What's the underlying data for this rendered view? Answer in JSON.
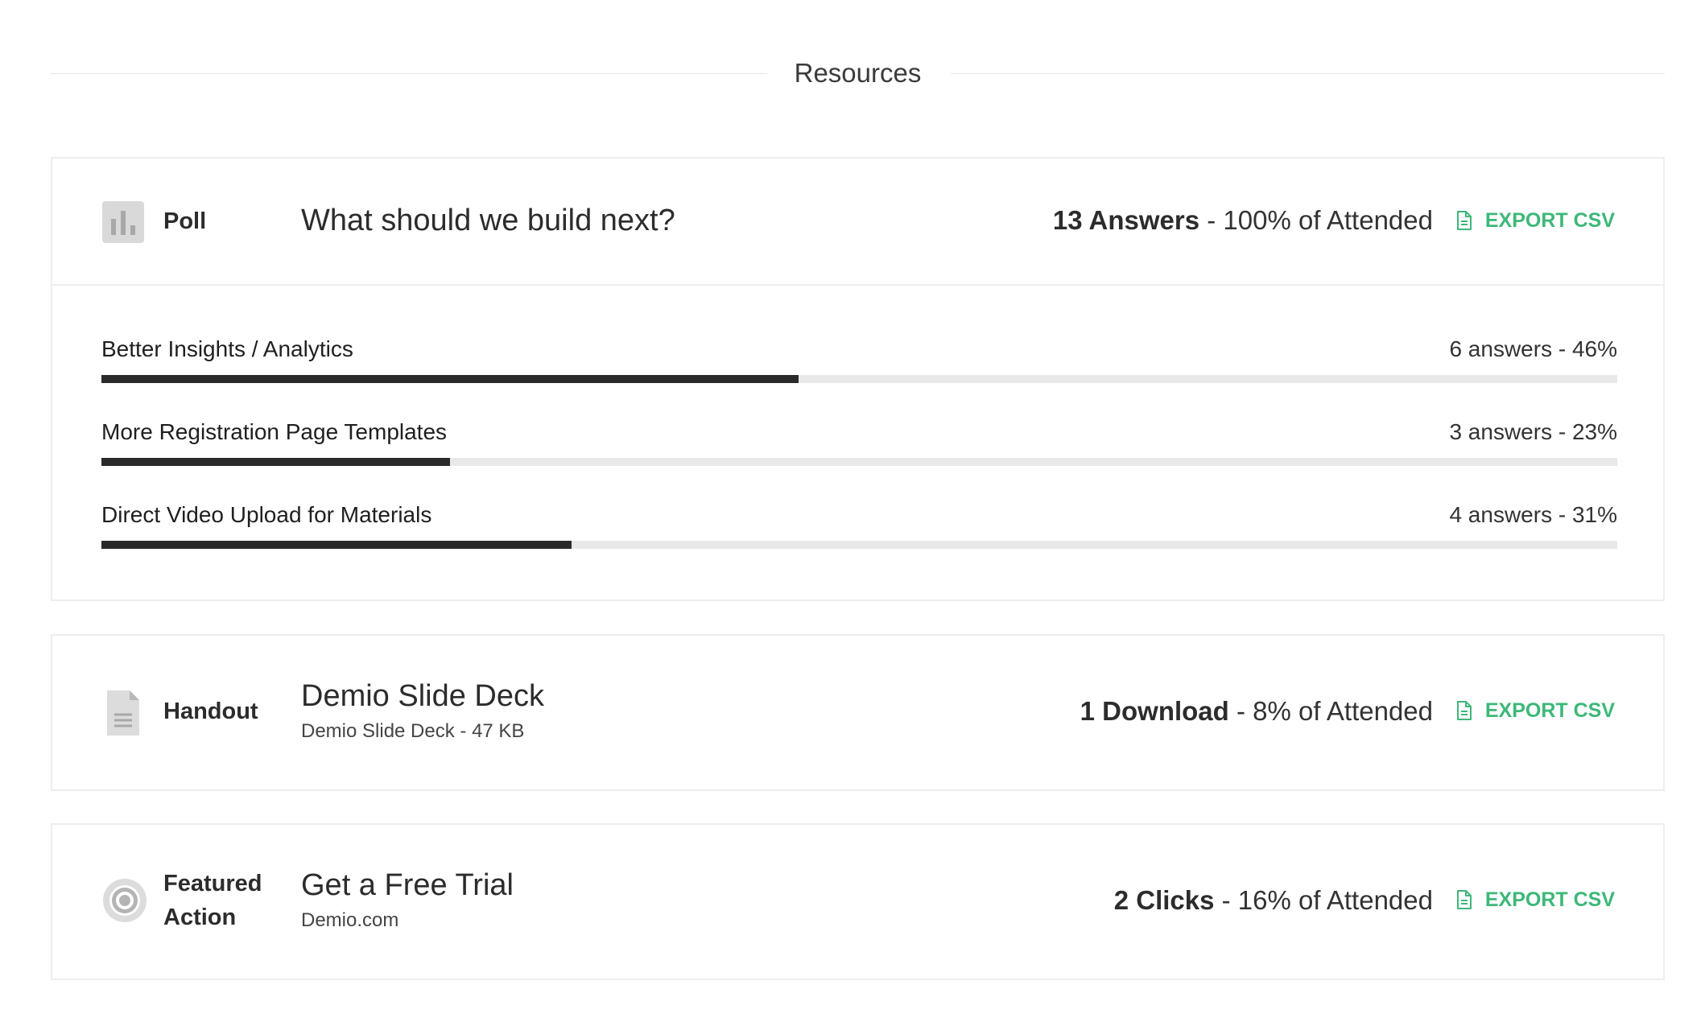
{
  "section": {
    "title": "Resources"
  },
  "colors": {
    "accent": "#3cb878",
    "bar_fill": "#2a2a2a",
    "bar_track": "#e8e8e8"
  },
  "poll": {
    "type_label": "Poll",
    "icon": "bar-chart-icon",
    "title": "What should we build next?",
    "stat_number": "13 Answers",
    "stat_rest": " - 100% of Attended",
    "export_label": "EXPORT CSV",
    "options": [
      {
        "label": "Better Insights / Analytics",
        "count": "6 answers - 46%",
        "percent": 46
      },
      {
        "label": "More Registration Page Templates",
        "count": "3 answers - 23%",
        "percent": 23
      },
      {
        "label": "Direct Video Upload for Materials",
        "count": "4 answers - 31%",
        "percent": 31
      }
    ]
  },
  "handout": {
    "type_label": "Handout",
    "icon": "document-icon",
    "title": "Demio Slide Deck",
    "subtitle": "Demio Slide Deck - 47 KB",
    "stat_number": "1 Download",
    "stat_rest": " - 8% of Attended",
    "export_label": "EXPORT CSV"
  },
  "featured": {
    "type_label": "Featured Action",
    "icon": "target-icon",
    "title": "Get a Free Trial",
    "subtitle": "Demio.com",
    "stat_number": "2 Clicks",
    "stat_rest": " - 16% of Attended",
    "export_label": "EXPORT CSV"
  }
}
